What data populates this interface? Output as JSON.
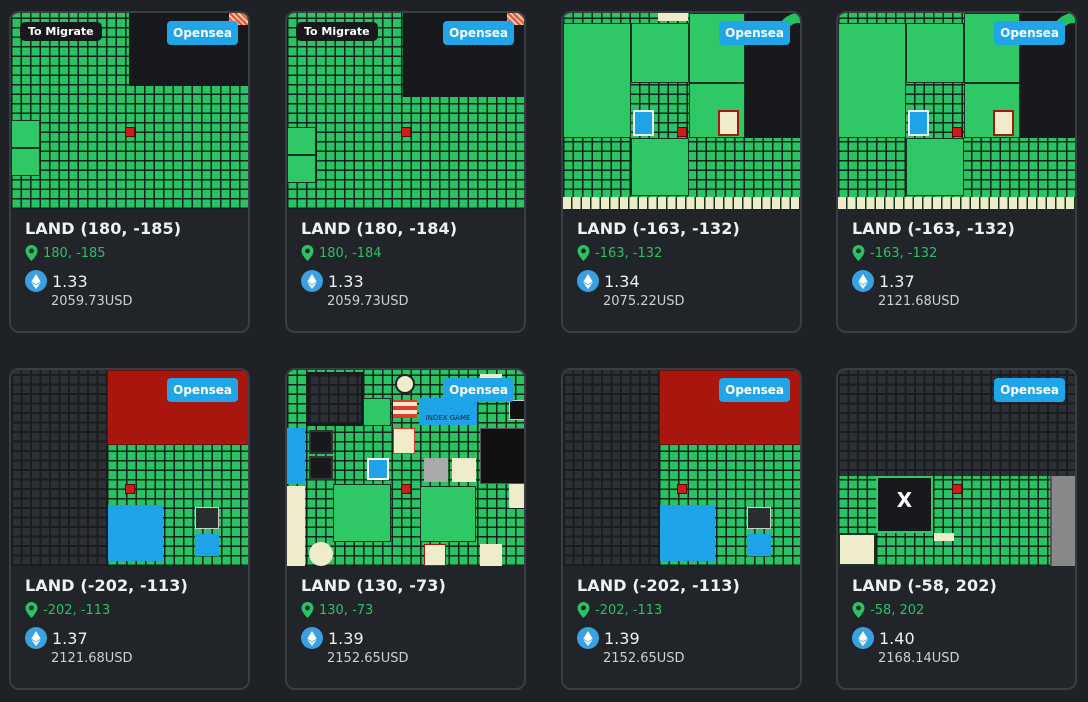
{
  "colors": {
    "accent_green": "#29c264",
    "opensea_blue": "#1fa5e8",
    "background": "#1e2125"
  },
  "icons": {
    "location": "location-pin-icon",
    "currency": "ethereum-icon"
  },
  "cards": [
    {
      "title": "LAND (180, -185)",
      "coords": "180, -185",
      "eth": "1.33",
      "usd": "2059.73USD",
      "badge": "Opensea",
      "migrate": "To Migrate"
    },
    {
      "title": "LAND (180, -184)",
      "coords": "180, -184",
      "eth": "1.33",
      "usd": "2059.73USD",
      "badge": "Opensea",
      "migrate": "To Migrate"
    },
    {
      "title": "LAND (-163, -132)",
      "coords": "-163, -132",
      "eth": "1.34",
      "usd": "2075.22USD",
      "badge": "Opensea"
    },
    {
      "title": "LAND (-163, -132)",
      "coords": "-163, -132",
      "eth": "1.37",
      "usd": "2121.68USD",
      "badge": "Opensea"
    },
    {
      "title": "LAND (-202, -113)",
      "coords": "-202, -113",
      "eth": "1.37",
      "usd": "2121.68USD",
      "badge": "Opensea"
    },
    {
      "title": "LAND (130, -73)",
      "coords": "130, -73",
      "eth": "1.39",
      "usd": "2152.65USD",
      "badge": "Opensea",
      "map_label": "INDEX GAME"
    },
    {
      "title": "LAND (-202, -113)",
      "coords": "-202, -113",
      "eth": "1.39",
      "usd": "2152.65USD",
      "badge": "Opensea"
    },
    {
      "title": "LAND (-58, 202)",
      "coords": "-58, 202",
      "eth": "1.40",
      "usd": "2168.14USD",
      "badge": "Opensea",
      "map_label": "X"
    }
  ]
}
